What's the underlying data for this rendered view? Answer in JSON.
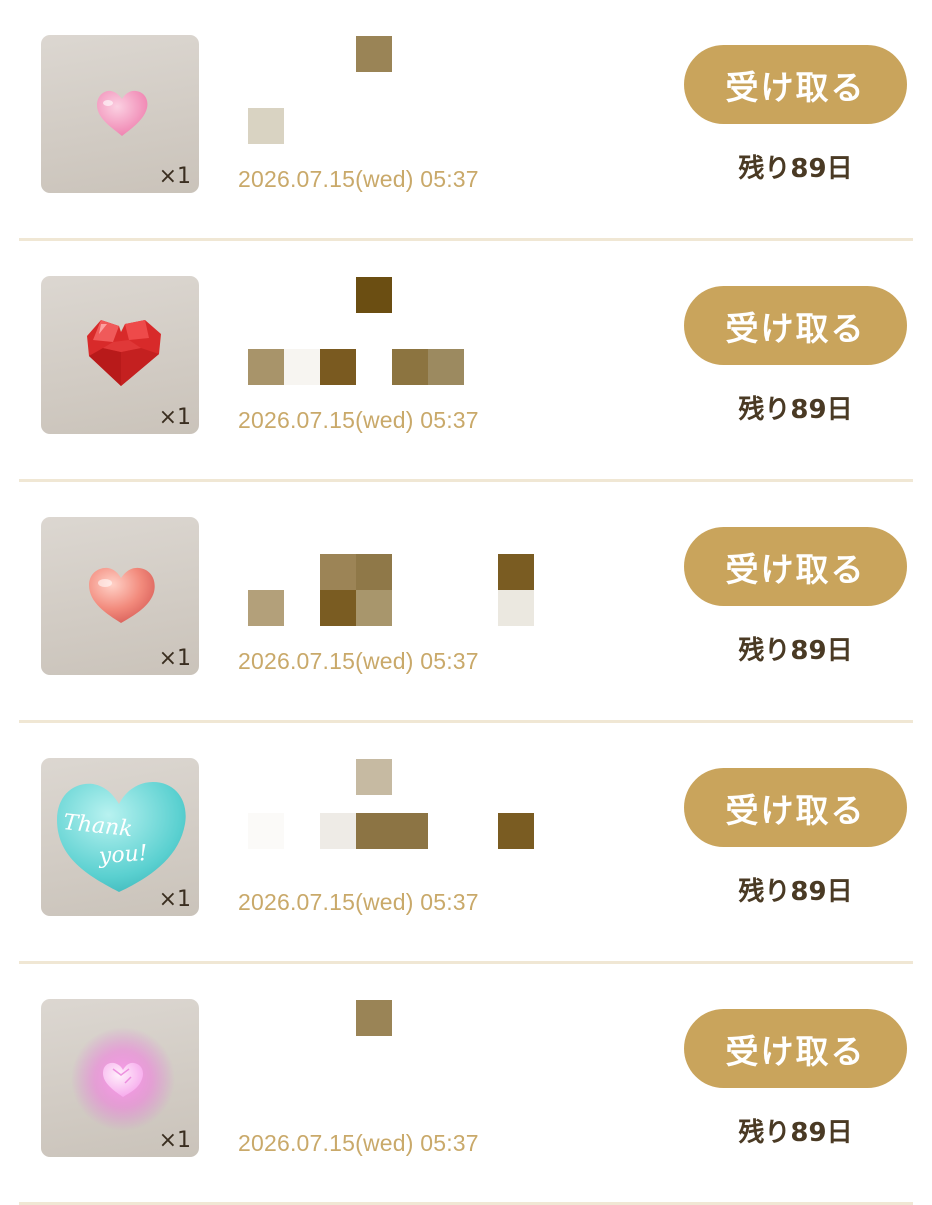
{
  "gifts": [
    {
      "icon": "pink-heart-icon",
      "quantity": "×1",
      "date": "2026.07.15(wed) 05:37",
      "receive_label": "受け取る",
      "remaining": "残り89日"
    },
    {
      "icon": "red-gem-heart-icon",
      "quantity": "×1",
      "date": "2026.07.15(wed) 05:37",
      "receive_label": "受け取る",
      "remaining": "残り89日"
    },
    {
      "icon": "peach-heart-icon",
      "quantity": "×1",
      "date": "2026.07.15(wed) 05:37",
      "receive_label": "受け取る",
      "remaining": "残り89日"
    },
    {
      "icon": "thank-you-heart-icon",
      "quantity": "×1",
      "date": "2026.07.15(wed) 05:37",
      "receive_label": "受け取る",
      "remaining": "残り89日",
      "icon_text": "Thank you!"
    },
    {
      "icon": "glowing-pink-heart-icon",
      "quantity": "×1",
      "date": "2026.07.15(wed) 05:37",
      "receive_label": "受け取る",
      "remaining": "残り89日"
    }
  ],
  "colors": {
    "button": "#c9a45c",
    "date_text": "#c9a96a",
    "remaining_text": "#4a3a24",
    "divider": "#f0e7d4",
    "thumb_bg": "#d6d0c9"
  }
}
